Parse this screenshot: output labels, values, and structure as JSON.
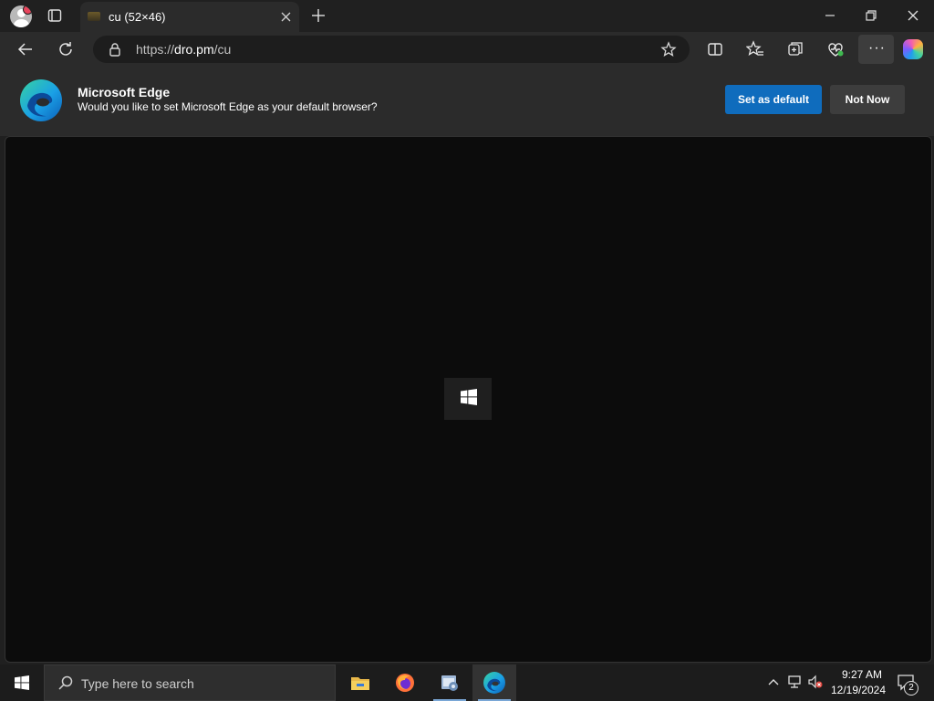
{
  "browser": {
    "tab": {
      "title": "cu (52×46)"
    },
    "address": {
      "scheme": "https://",
      "host": "dro.pm",
      "path": "/cu"
    },
    "more_label": "···"
  },
  "infobar": {
    "title": "Microsoft Edge",
    "message": "Would you like to set Microsoft Edge as your default browser?",
    "primary_button": "Set as default",
    "secondary_button": "Not Now"
  },
  "taskbar": {
    "search_placeholder": "Type here to search",
    "apps": [
      "file-explorer",
      "firefox",
      "system-config",
      "microsoft-edge"
    ],
    "clock": {
      "time": "9:27 AM",
      "date": "12/19/2024"
    },
    "notification_count": "2"
  },
  "colors": {
    "primary_button": "#0f6cbd",
    "content_background": "#0c0c0c",
    "chrome_background": "#202020"
  }
}
